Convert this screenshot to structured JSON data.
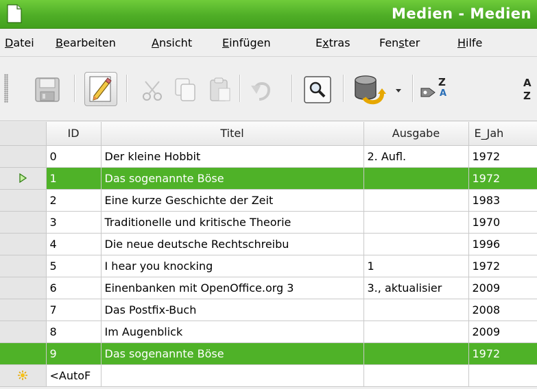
{
  "window": {
    "title": "Medien - Medien",
    "icon": "document-icon",
    "accent": "#4fae27"
  },
  "menu": [
    {
      "id": "datei",
      "label": "Datei"
    },
    {
      "id": "bearbeiten",
      "label": "Bearbeiten"
    },
    {
      "id": "ansicht",
      "label": "Ansicht"
    },
    {
      "id": "einfuegen",
      "label": "Einfügen"
    },
    {
      "id": "extras",
      "label": "Extras"
    },
    {
      "id": "fenster",
      "label": "Fenster"
    },
    {
      "id": "hilfe",
      "label": "Hilfe"
    }
  ],
  "toolbar": {
    "buttons": [
      {
        "icon": "save-icon",
        "enabled": false
      },
      {
        "icon": "edit-pencil-icon",
        "enabled": true,
        "pressed": true
      },
      {
        "icon": "cut-icon",
        "enabled": false
      },
      {
        "icon": "copy-icon",
        "enabled": false
      },
      {
        "icon": "paste-icon",
        "enabled": false
      },
      {
        "icon": "undo-icon",
        "enabled": false
      },
      {
        "icon": "find-record-icon",
        "enabled": true
      },
      {
        "icon": "data-source-icon",
        "enabled": true
      },
      {
        "icon": "dropdown-arrow-icon",
        "enabled": true
      },
      {
        "icon": "sort-ascending-icon",
        "enabled": true
      },
      {
        "icon": "sort-az-icon",
        "enabled": true
      }
    ],
    "sort_label_top": "Z",
    "sort_label_bottom": "A",
    "sort_az_top": "A",
    "sort_az_bottom": "Z"
  },
  "grid": {
    "columns": [
      "ID",
      "Titel",
      "Ausgabe",
      "E_Jah"
    ],
    "rows": [
      {
        "id": "0",
        "titel": "Der kleine Hobbit",
        "ausgabe": "2. Aufl.",
        "jahr": "1972",
        "selected": false,
        "current": false
      },
      {
        "id": "1",
        "titel": "Das sogenannte Böse",
        "ausgabe": "",
        "jahr": "1972",
        "selected": true,
        "current": true
      },
      {
        "id": "2",
        "titel": "Eine kurze Geschichte der Zeit",
        "ausgabe": "",
        "jahr": "1983",
        "selected": false,
        "current": false
      },
      {
        "id": "3",
        "titel": "Traditionelle und kritische Theorie",
        "ausgabe": "",
        "jahr": "1970",
        "selected": false,
        "current": false
      },
      {
        "id": "4",
        "titel": "Die neue deutsche Rechtschreibu",
        "ausgabe": "",
        "jahr": "1996",
        "selected": false,
        "current": false
      },
      {
        "id": "5",
        "titel": "I hear you knocking",
        "ausgabe": "1",
        "jahr": "1972",
        "selected": false,
        "current": false
      },
      {
        "id": "6",
        "titel": "Einenbanken mit OpenOffice.org 3",
        "ausgabe": "3., aktualisier",
        "jahr": "2009",
        "selected": false,
        "current": false
      },
      {
        "id": "7",
        "titel": "Das Postfix-Buch",
        "ausgabe": "",
        "jahr": "2008",
        "selected": false,
        "current": false
      },
      {
        "id": "8",
        "titel": "Im Augenblick",
        "ausgabe": "",
        "jahr": "2009",
        "selected": false,
        "current": false
      },
      {
        "id": "9",
        "titel": "Das sogenannte Böse",
        "ausgabe": "",
        "jahr": "1972",
        "selected": true,
        "current": false
      }
    ],
    "new_row": {
      "id": "<AutoF",
      "icon": "new-record-star-icon"
    },
    "selection_color": "#4fb228"
  }
}
